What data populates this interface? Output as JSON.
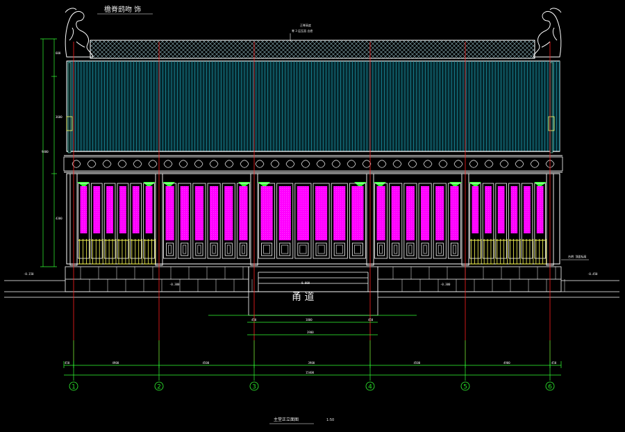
{
  "drawing": {
    "annotation_top_left": "檐脊鸱吻 饰",
    "ridge_note_a": "正脊高度",
    "ridge_note_b": "脊 3 层瓦面 出檐",
    "corridor_label": "甬 道",
    "title": "主堂正立面图",
    "scale": "1:50",
    "elev_left": "-0.150",
    "elev_right": "-0.450",
    "elev_mid_left": "-0.300",
    "elev_mid_right": "-0.300",
    "elev_center": "0.000",
    "note_right": "台明 顶面标高",
    "total_length": "15400",
    "bay_dims": [
      "450",
      "4900",
      "4500",
      "3900",
      "4500",
      "4900",
      "450"
    ],
    "corridor_dims": [
      "450",
      "1800",
      "450"
    ],
    "corridor_total": "3900",
    "height_dims": [
      "600",
      "3600",
      "4300",
      "9400"
    ],
    "axes": [
      "1",
      "2",
      "3",
      "4",
      "5",
      "6"
    ]
  },
  "colors": {
    "background": "#000000",
    "outline": "#ffffff",
    "roof_tile": "#1a8a9a",
    "door_panel": "#ff00ff",
    "bracket": "#33ff33",
    "axis_line": "#ff2020",
    "dim_line": "#33ff33",
    "railing": "#ffff55"
  }
}
